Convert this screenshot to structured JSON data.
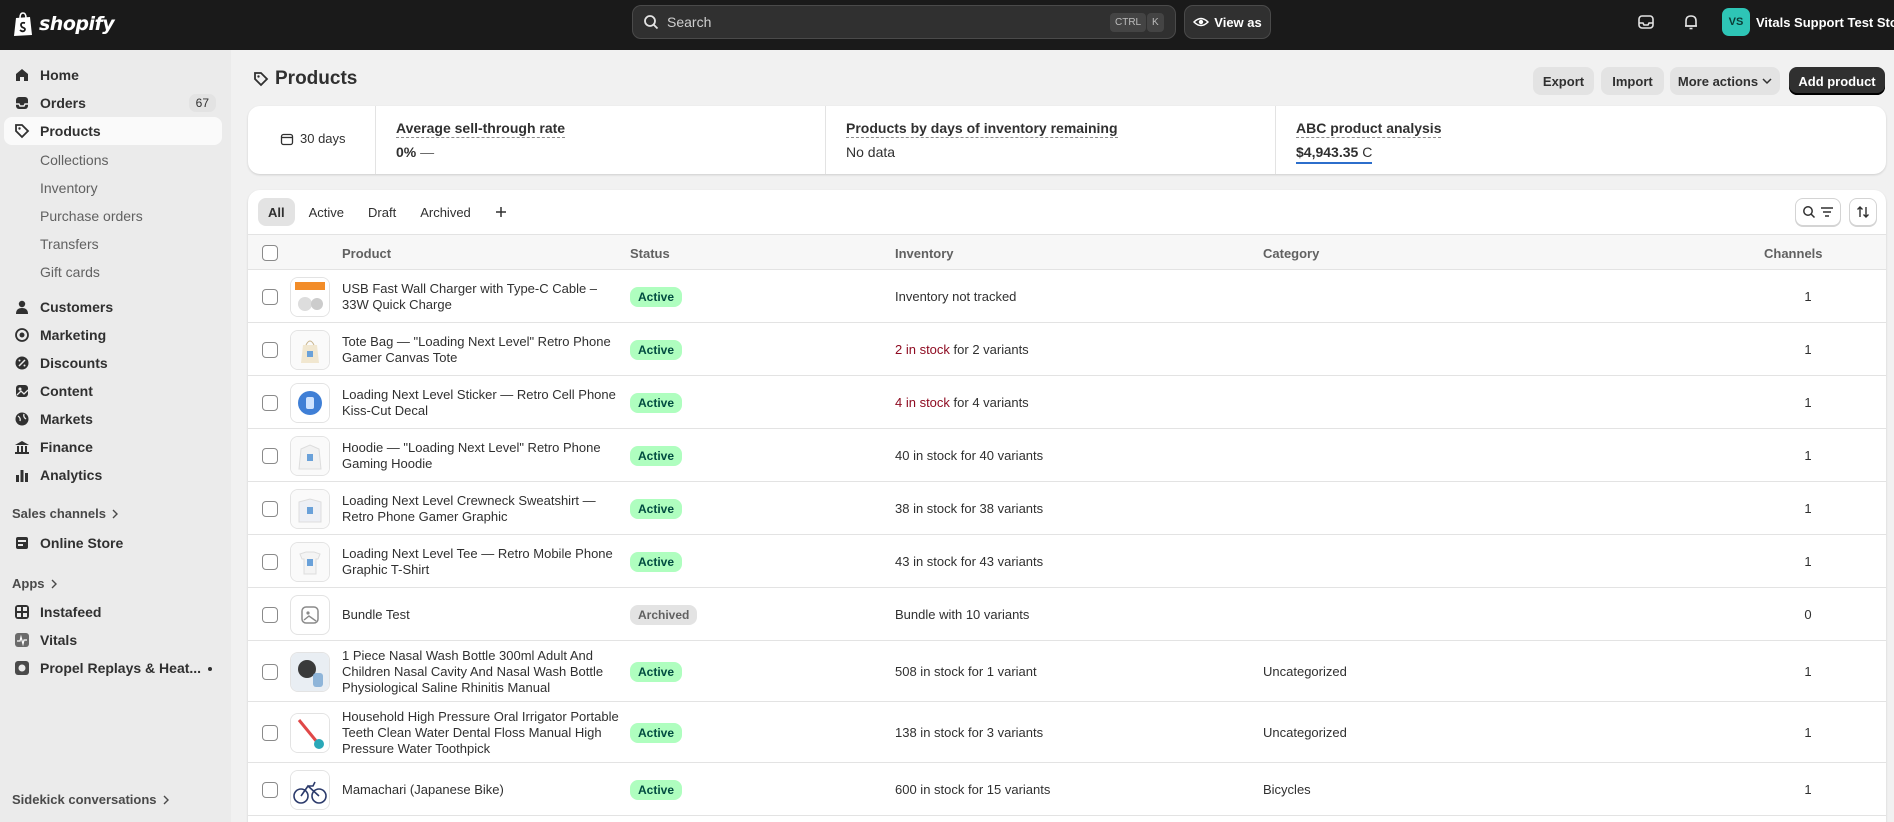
{
  "topbar": {
    "logo_text": "shopify",
    "search_placeholder": "Search",
    "shortcut_1": "CTRL",
    "shortcut_2": "K",
    "view_as": "View as",
    "avatar_initials": "VS",
    "store_name": "Vitals Support Test Store"
  },
  "sidebar": {
    "items": [
      {
        "label": "Home",
        "icon": "home-icon"
      },
      {
        "label": "Orders",
        "icon": "orders-icon",
        "count": "67"
      },
      {
        "label": "Products",
        "icon": "tag-icon"
      }
    ],
    "product_subitems": [
      "Collections",
      "Inventory",
      "Purchase orders",
      "Transfers",
      "Gift cards"
    ],
    "items2": [
      {
        "label": "Customers",
        "icon": "person-icon"
      },
      {
        "label": "Marketing",
        "icon": "target-icon"
      },
      {
        "label": "Discounts",
        "icon": "discount-icon"
      },
      {
        "label": "Content",
        "icon": "content-icon"
      },
      {
        "label": "Markets",
        "icon": "globe-icon"
      },
      {
        "label": "Finance",
        "icon": "bank-icon"
      },
      {
        "label": "Analytics",
        "icon": "chart-icon"
      }
    ],
    "sales_channels_title": "Sales channels",
    "online_store": "Online Store",
    "apps_title": "Apps",
    "apps": [
      "Instafeed",
      "Vitals",
      "Propel Replays & Heat..."
    ],
    "sidekick": "Sidekick conversations"
  },
  "page": {
    "title": "Products",
    "export": "Export",
    "import": "Import",
    "more_actions": "More actions",
    "add_product": "Add product"
  },
  "metrics": {
    "period": "30 days",
    "sell_through_title": "Average sell-through rate",
    "sell_through_value": "0%",
    "sell_through_trend": "—",
    "days_inventory_title": "Products by days of inventory remaining",
    "days_inventory_value": "No data",
    "abc_title": "ABC product analysis",
    "abc_value": "$4,943.35",
    "abc_grade": "C"
  },
  "tabs": [
    "All",
    "Active",
    "Draft",
    "Archived"
  ],
  "table": {
    "headers": {
      "product": "Product",
      "status": "Status",
      "inventory": "Inventory",
      "category": "Category",
      "channels": "Channels"
    },
    "rows": [
      {
        "name": "USB Fast Wall Charger with Type-C Cable – 33W Quick Charge",
        "status": "Active",
        "inv_main": "Inventory not tracked",
        "inv_rest": "",
        "low": false,
        "category": "",
        "channels": "1"
      },
      {
        "name": "Tote Bag — \"Loading Next Level\" Retro Phone Gamer Canvas Tote",
        "status": "Active",
        "inv_main": "2 in stock",
        "inv_rest": " for 2 variants",
        "low": true,
        "category": "",
        "channels": "1"
      },
      {
        "name": "Loading Next Level Sticker — Retro Cell Phone Kiss-Cut Decal",
        "status": "Active",
        "inv_main": "4 in stock",
        "inv_rest": " for 4 variants",
        "low": true,
        "category": "",
        "channels": "1"
      },
      {
        "name": "Hoodie — \"Loading Next Level\" Retro Phone Gaming Hoodie",
        "status": "Active",
        "inv_main": "40 in stock",
        "inv_rest": " for 40 variants",
        "low": false,
        "category": "",
        "channels": "1"
      },
      {
        "name": "Loading Next Level Crewneck Sweatshirt — Retro Phone Gamer Graphic",
        "status": "Active",
        "inv_main": "38 in stock",
        "inv_rest": " for 38 variants",
        "low": false,
        "category": "",
        "channels": "1"
      },
      {
        "name": "Loading Next Level Tee — Retro Mobile Phone Graphic T-Shirt",
        "status": "Active",
        "inv_main": "43 in stock",
        "inv_rest": " for 43 variants",
        "low": false,
        "category": "",
        "channels": "1"
      },
      {
        "name": "Bundle Test",
        "status": "Archived",
        "inv_main": "Bundle with 10 variants",
        "inv_rest": "",
        "low": false,
        "category": "",
        "channels": "0"
      },
      {
        "name": "1 Piece Nasal Wash Bottle 300ml Adult And Children Nasal Cavity And Nasal Wash Bottle Physiological Saline Rhinitis Manual",
        "status": "Active",
        "inv_main": "508 in stock",
        "inv_rest": " for 1 variant",
        "low": false,
        "category": "Uncategorized",
        "channels": "1"
      },
      {
        "name": "Household High Pressure Oral Irrigator Portable Teeth Clean Water Dental Floss Manual High Pressure Water Toothpick",
        "status": "Active",
        "inv_main": "138 in stock",
        "inv_rest": " for 3 variants",
        "low": false,
        "category": "Uncategorized",
        "channels": "1"
      },
      {
        "name": "Mamachari (Japanese Bike)",
        "status": "Active",
        "inv_main": "600 in stock",
        "inv_rest": " for 15 variants",
        "low": false,
        "category": "Bicycles",
        "channels": "1"
      }
    ]
  }
}
